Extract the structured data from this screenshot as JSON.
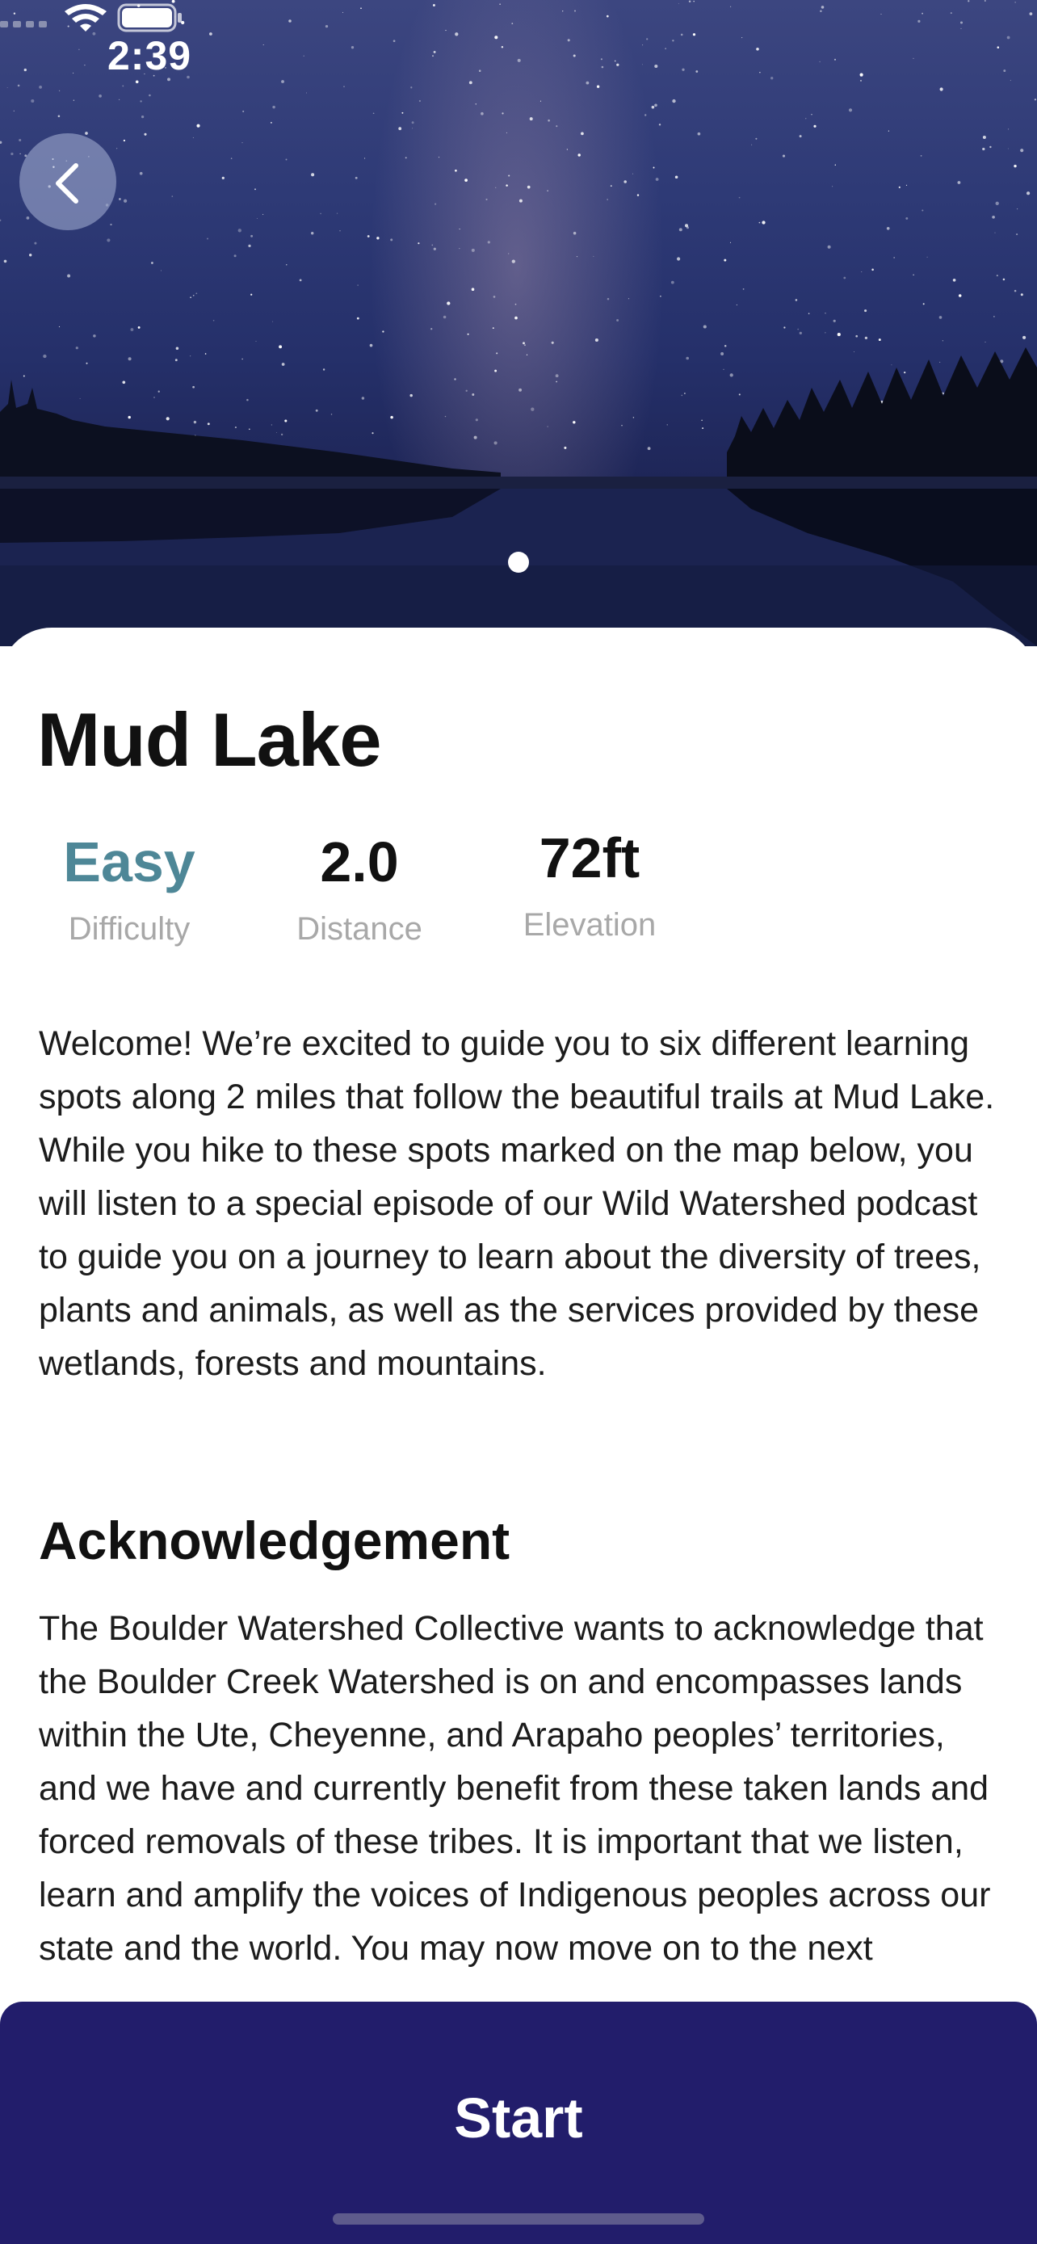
{
  "status_bar": {
    "time": "2:39"
  },
  "hero": {
    "image_description": "night-sky-lake",
    "pager": {
      "count": 1,
      "active": 0
    }
  },
  "trail": {
    "name": "Mud Lake",
    "stats": [
      {
        "value": "Easy",
        "label": "Difficulty",
        "accent": "#4e8797"
      },
      {
        "value": "2.0",
        "label": "Distance"
      },
      {
        "value": "72ft",
        "label": "Elevation"
      }
    ],
    "description": "Welcome! We’re excited to guide you to six different learning spots along 2 miles that follow the beautiful trails at Mud Lake. While you hike to these spots marked on the map below, you will listen to a special episode of our Wild Watershed podcast to guide you on a journey to learn about the diversity of trees, plants and animals, as well as the services provided by these wetlands, forests and mountains.",
    "acknowledgement": {
      "title": "Acknowledgement",
      "text": "The Boulder Watershed Collective wants to acknowledge that the Boulder Creek Watershed is on and encompasses lands within the Ute, Cheyenne, and Arapaho peoples’ territories, and we have and currently benefit from these taken lands and forced removals of these tribes. It is important that we listen, learn and amplify the voices of Indigenous peoples across our state and the world. You may now move on to the next"
    }
  },
  "actions": {
    "start_label": "Start"
  },
  "colors": {
    "primary": "#221d6b",
    "accent": "#4e8797",
    "muted": "#a8a8a8"
  },
  "icons": {
    "back": "chevron-left-icon",
    "wifi": "wifi-icon",
    "battery": "battery-icon",
    "signal": "cellular-signal-icon"
  }
}
